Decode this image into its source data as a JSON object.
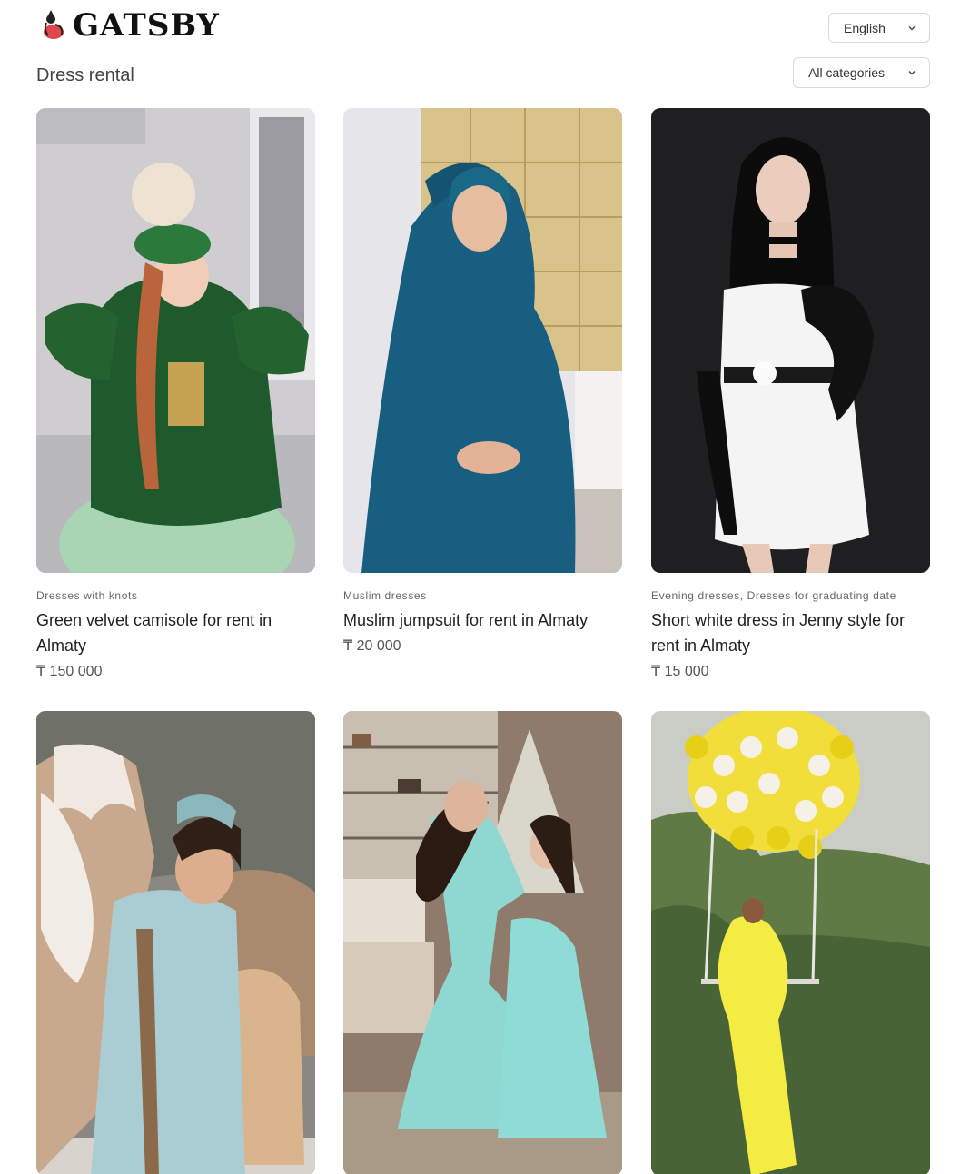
{
  "header": {
    "logo_text": "GATSBY",
    "language": "English",
    "category_filter": "All categories"
  },
  "page": {
    "title": "Dress rental"
  },
  "products": [
    {
      "categories": "Dresses with knots",
      "name": "Green velvet camisole for rent in Almaty",
      "price": "₸ 150 000"
    },
    {
      "categories": "Muslim dresses",
      "name": "Muslim jumpsuit for rent in Almaty",
      "price": "₸ 20 000"
    },
    {
      "categories": "Evening dresses, Dresses for graduating date",
      "name": "Short white dress in Jenny style for rent in Almaty",
      "price": "₸ 15 000"
    },
    {
      "categories": "",
      "name": "",
      "price": ""
    },
    {
      "categories": "",
      "name": "",
      "price": ""
    },
    {
      "categories": "",
      "name": "",
      "price": ""
    }
  ],
  "icons": {
    "logo": "gatsby-logo-icon",
    "dropdown": "chevron-down-icon"
  }
}
